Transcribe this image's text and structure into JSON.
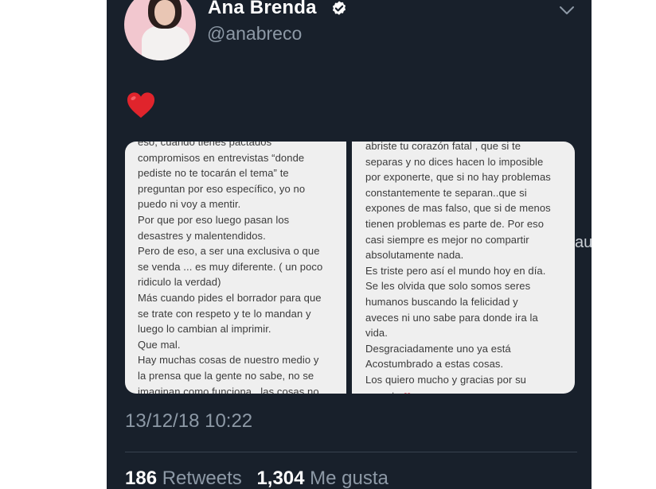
{
  "tweet": {
    "display_name": "Ana Brenda",
    "handle": "@anabreco",
    "verified": true,
    "body_emoji": "❤️",
    "timestamp": "13/12/18 10:22",
    "stats": {
      "retweets_count": "186",
      "retweets_label": "Retweets",
      "likes_count": "1,304",
      "likes_label": "Me gusta"
    }
  },
  "images": {
    "left_lines": [
      "eso, cuando tienes pactados",
      "compromisos en entrevistas “donde",
      "pediste no te tocarán el tema” te",
      "preguntan por eso específico, yo no",
      "puedo ni voy a mentir.",
      "Por que por eso luego pasan los",
      "desastres y malentendidos.",
      "Pero de eso, a ser una exclusiva o que",
      "se venda ... es muy diferente. ( un poco",
      "ridiculo la verdad)",
      "Más cuando pides el borrador para que",
      "se trate con respeto y te lo mandan y",
      "luego lo cambian al imprimir.",
      "Que mal.",
      "Hay muchas cosas de nuestro medio y",
      "la prensa que la gente no sabe, no se",
      "imaginan como funciona.. las cosas no"
    ],
    "right_lines": [
      "abriste tu corazón fatal , que si te",
      "separas y no dices hacen lo imposible",
      "por exponerte, que si no hay problemas",
      "constantemente te separan..que si",
      "expones de mas falso, que si de menos",
      "tienen problemas es parte de. Por eso",
      "casi siempre es mejor no compartir",
      "absolutamente nada.",
      "Es triste pero así el mundo hoy en día.",
      "Se les olvida que solo somos seres",
      "humanos buscando la felicidad y",
      "aveces ni uno sabe para donde ira la",
      "vida.",
      "Desgraciadamente uno ya está",
      "Acostumbrado a estas cosas.",
      "Los quiero mucho y gracias por su",
      "respeto"
    ]
  },
  "watermark_text": "au",
  "colors": {
    "background": "#18202b",
    "text_primary": "#ffffff",
    "text_secondary": "#8d99a6",
    "verified_badge": "#ffffff",
    "heart": "#e0242c"
  },
  "icons": {
    "verified": "verified-badge-icon",
    "menu": "chevron-down-icon",
    "heart": "red-heart-emoji"
  }
}
